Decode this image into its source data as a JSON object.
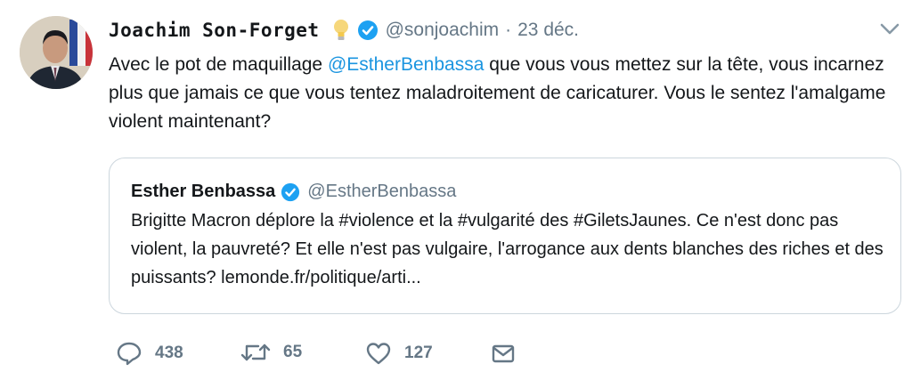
{
  "tweet": {
    "display_name": "Joachim Son-Forget",
    "handle": "@sonjoachim",
    "separator": "·",
    "date": "23 déc.",
    "text_before": "Avec le pot de maquillage ",
    "mention": "@EstherBenbassa",
    "text_after": " que vous vous mettez sur la tête, vous incarnez plus que jamais ce que vous tentez maladroitement de caricaturer. Vous le sentez l'amalgame violent maintenant?"
  },
  "quoted_tweet": {
    "display_name": "Esther Benbassa",
    "handle": "@EstherBenbassa",
    "text": "Brigitte Macron déplore la #violence et la #vulgarité des #GiletsJaunes. Ce n'est donc pas violent, la pauvreté?  Et elle n'est pas vulgaire, l'arrogance aux dents blanches des riches et des puissants?  lemonde.fr/politique/arti..."
  },
  "actions": {
    "reply_count": "438",
    "retweet_count": "65",
    "like_count": "127"
  },
  "colors": {
    "link": "#1b95e0",
    "muted": "#657786",
    "verified": "#1da1f2",
    "border": "#ccd6dd"
  },
  "icons": [
    "lightbulb-icon",
    "verified-icon",
    "chevron-down-icon",
    "reply-icon",
    "retweet-icon",
    "like-icon",
    "message-icon"
  ]
}
